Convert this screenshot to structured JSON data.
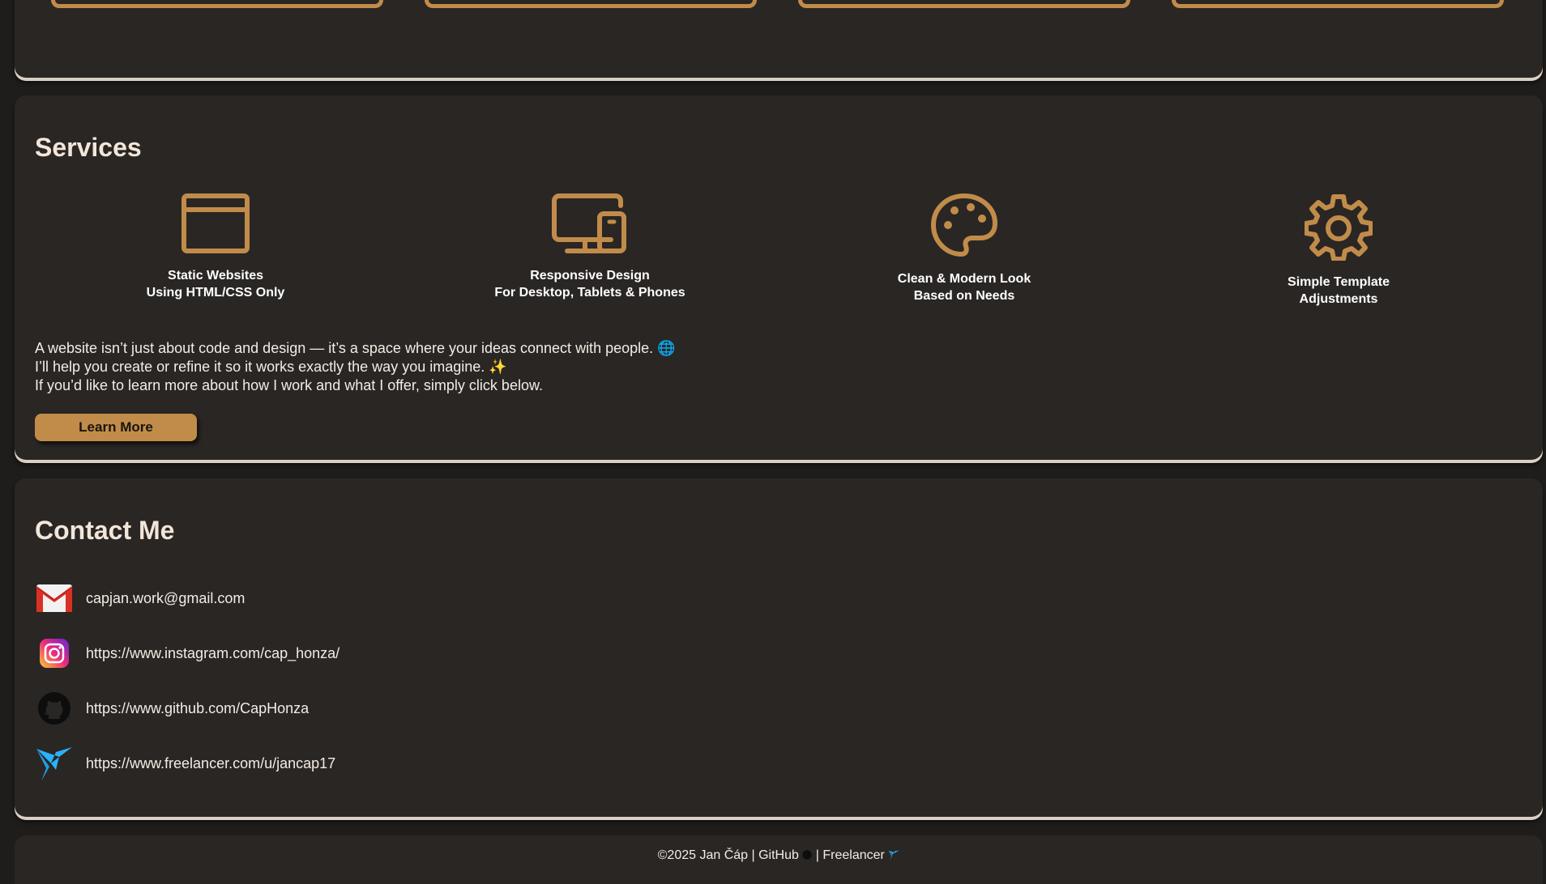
{
  "services": {
    "heading": "Services",
    "items": [
      {
        "icon": "browser-window-icon",
        "line1": "Static Websites",
        "line2": "Using HTML/CSS Only"
      },
      {
        "icon": "devices-icon",
        "line1": "Responsive Design",
        "line2": "For Desktop, Tablets & Phones"
      },
      {
        "icon": "palette-icon",
        "line1": "Clean & Modern Look",
        "line2": "Based on Needs"
      },
      {
        "icon": "gear-icon",
        "line1": "Simple Template",
        "line2": "Adjustments"
      }
    ],
    "description": [
      "A website isn’t just about code and design — it’s a space where your ideas connect with people. 🌐",
      "I’ll help you create or refine it so it works exactly the way you imagine. ✨",
      "If you’d like to learn more about how I work and what I offer, simply click below."
    ],
    "button_label": "Learn More"
  },
  "contact": {
    "heading": "Contact Me",
    "items": [
      {
        "icon": "gmail-icon",
        "text": "capjan.work@gmail.com"
      },
      {
        "icon": "instagram-icon",
        "text": "https://www.instagram.com/cap_honza/"
      },
      {
        "icon": "github-icon",
        "text": "https://www.github.com/CapHonza"
      },
      {
        "icon": "freelancer-icon",
        "text": "https://www.freelancer.com/u/jancap17"
      }
    ]
  },
  "footer": {
    "copyright": "©2025 Jan Čáp",
    "sep1": " | ",
    "github_label": "GitHub",
    "sep2": " | ",
    "freelancer_label": "Freelancer"
  },
  "colors": {
    "accent": "#c18c4a",
    "panel": "#2a2624",
    "background": "#1f1d1b"
  }
}
